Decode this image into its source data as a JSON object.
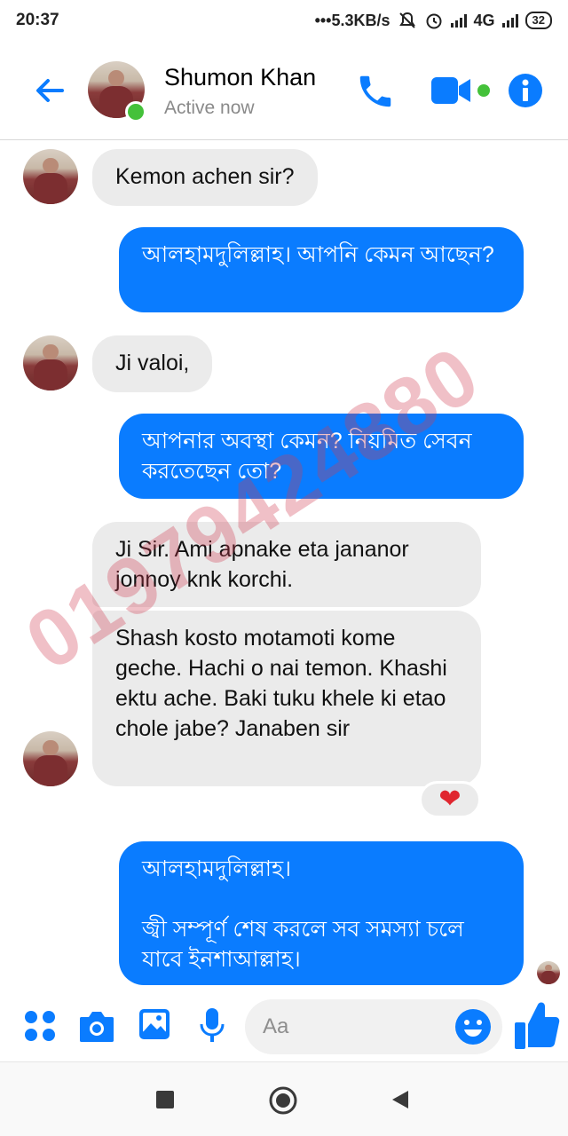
{
  "status_bar": {
    "time": "20:37",
    "network_speed": "•••5.3KB/s",
    "network_type": "4G",
    "battery": "32",
    "icons": [
      "mute-icon",
      "alarm-icon",
      "signal-icon",
      "signal-icon"
    ]
  },
  "header": {
    "contact_name": "Shumon Khan",
    "presence": "Active now",
    "icons": [
      "back-arrow-icon",
      "phone-icon",
      "video-camera-icon",
      "info-icon"
    ],
    "accent_color": "#0a7cff"
  },
  "messages": [
    {
      "direction": "incoming",
      "text": "Kemon achen sir?"
    },
    {
      "direction": "outgoing",
      "text": "আলহামদুলিল্লাহ। আপনি কেমন আছেন?"
    },
    {
      "direction": "incoming",
      "text": "Ji valoi,"
    },
    {
      "direction": "outgoing",
      "text": "আপনার অবস্থা কেমন? নিয়মিত সেবন করতেছেন তো?"
    },
    {
      "direction": "incoming",
      "text": "Ji Sir. Ami apnake eta jananor jonnoy knk korchi."
    },
    {
      "direction": "incoming",
      "text": "Shash kosto motamoti kome geche. Hachi o nai temon. Khashi ektu ache. Baki tuku khele ki etao chole jabe? Janaben sir",
      "reaction": "❤"
    },
    {
      "direction": "outgoing",
      "text": "আলহামদুলিল্লাহ।\n\nজ্বী সম্পূর্ণ শেষ করলে সব সমস্যা চলে যাবে ইনশাআল্লাহ।"
    }
  ],
  "watermark": "01979424880",
  "composer": {
    "placeholder": "Aa",
    "icons": [
      "menu-dots-icon",
      "camera-icon",
      "gallery-icon",
      "microphone-icon",
      "emoji-icon",
      "thumbs-up-icon"
    ]
  },
  "nav_bar": {
    "icons": [
      "recents-square-icon",
      "home-circle-icon",
      "back-triangle-icon"
    ]
  }
}
